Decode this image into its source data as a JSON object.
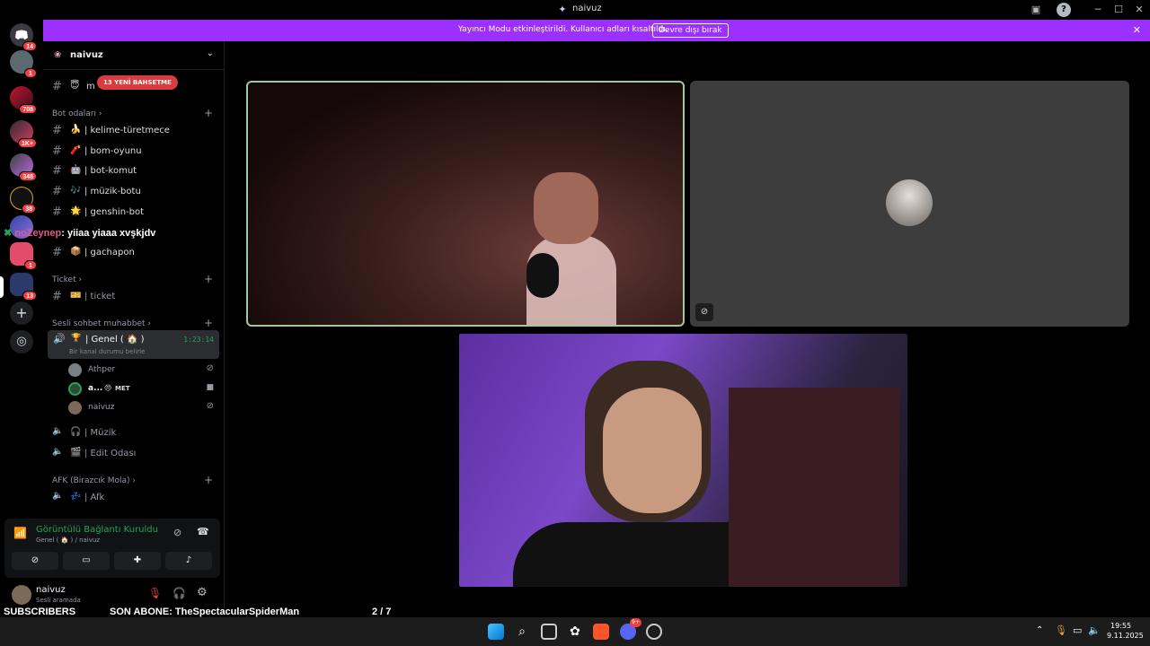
{
  "window": {
    "title": "naivuz"
  },
  "banner": {
    "text": "Yayıncı Modu etkinleştirildi. Kullanıcı adları kısaltıldı.",
    "button": "Devre dışı bırak"
  },
  "guild_badges": [
    "14",
    "1",
    "708",
    "1K+",
    "348",
    "38",
    "1",
    "13"
  ],
  "server": {
    "name": "naivuz"
  },
  "new_mentions": "13 YENİ BAHSETME",
  "first_channel_partial": "m",
  "categories": {
    "bot": "Bot odaları",
    "ticket": "Ticket",
    "voice": "Sesli sohbet muhabbet",
    "afk": "AFK (Birazcık Mola)"
  },
  "bot_channels": [
    {
      "emoji": "🍌",
      "name": "| kelime-türetmece"
    },
    {
      "emoji": "🧨",
      "name": "| bom-oyunu"
    },
    {
      "emoji": "🤖",
      "name": "| bot-komut"
    },
    {
      "emoji": "🎶",
      "name": "| müzik-botu"
    },
    {
      "emoji": "🌟",
      "name": "| genshin-bot"
    },
    {
      "emoji": "📦",
      "name": "| gachapon"
    }
  ],
  "overlay_chat": {
    "user": "noZeynep",
    "message": ": yiiaa yiaaa xvşkjdv"
  },
  "ticket_channel": {
    "emoji": "🎫",
    "name": "| ticket"
  },
  "voice_channel": {
    "emoji": "🏆",
    "name": "| Genel ( 🏠 )",
    "timer": "1:23:14",
    "status": "Bir kanal durumu belirle"
  },
  "voice_users": [
    {
      "name": "Athper",
      "tag": ""
    },
    {
      "name": "a...",
      "tag": "MET"
    },
    {
      "name": "naivuz",
      "tag": ""
    }
  ],
  "voice_channels_other": [
    {
      "emoji": "🎧",
      "name": "| Müzik"
    },
    {
      "emoji": "🎬",
      "name": "| Edit Odası"
    }
  ],
  "afk_channel": {
    "emoji": "💤",
    "name": "| Afk"
  },
  "connection": {
    "title": "Görüntülü Bağlantı Kuruldu",
    "sub": "Genel ( 🏠 ) / naivuz"
  },
  "user_panel": {
    "name": "naivuz",
    "status": "Sesli aramada"
  },
  "stream_overlay": {
    "subscribers": "SUBSCRIBERS",
    "last_sub": "SON ABONE: TheSpectacularSpiderMan",
    "progress_text": "2  / 7",
    "progress": 0.29
  },
  "clock": {
    "time": "19:55",
    "date": "9.11.2025"
  },
  "taskbar_badge": "9+",
  "colors": {
    "accent": "#9b30ff",
    "online": "#23a55a",
    "danger": "#f23f43"
  }
}
